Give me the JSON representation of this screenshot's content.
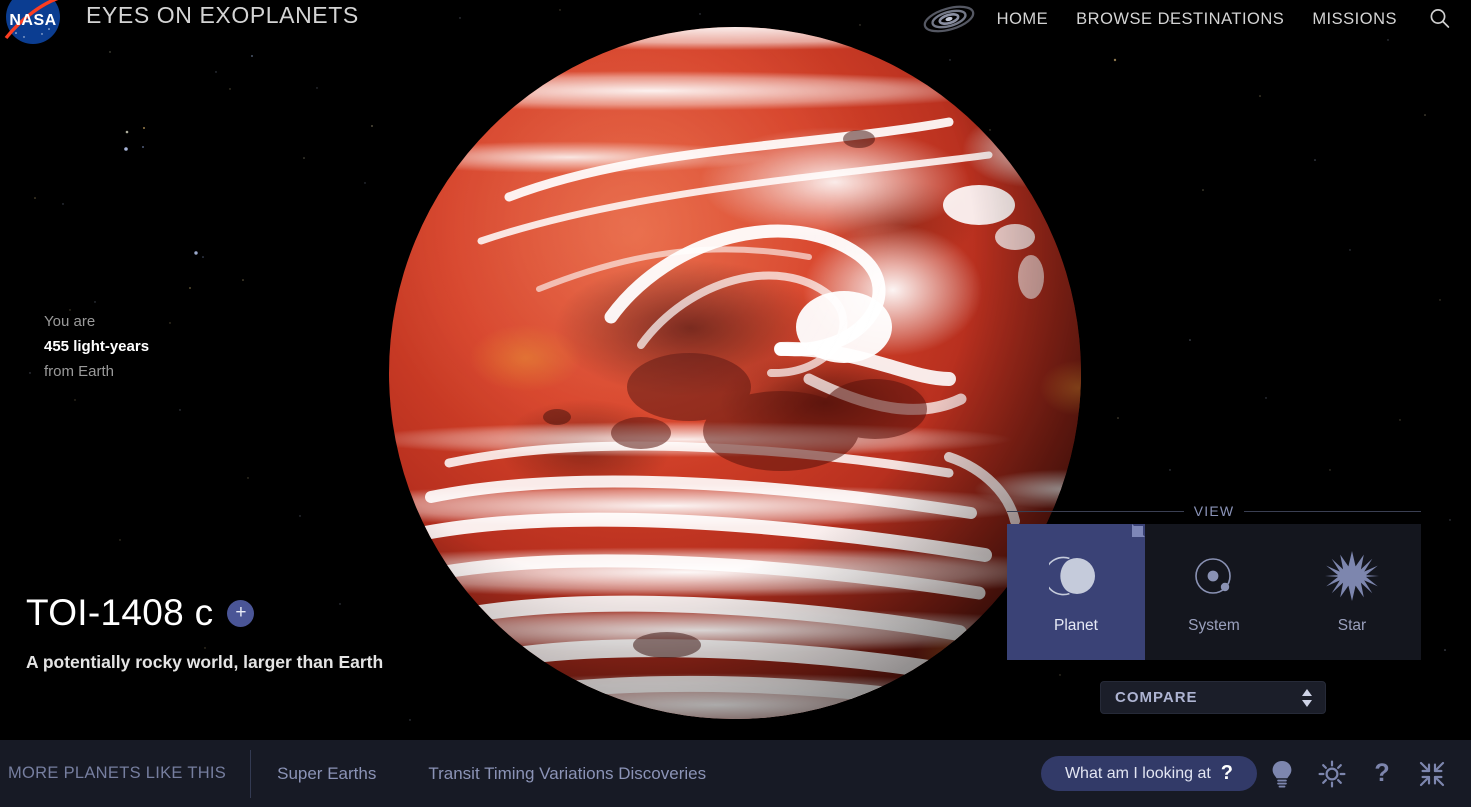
{
  "header": {
    "logo_alt": "NASA",
    "app_title": "EYES ON EXOPLANETS",
    "galaxy_icon": "galaxy-icon",
    "search_icon": "search-icon",
    "nav": [
      {
        "label": "HOME"
      },
      {
        "label": "BROWSE DESTINATIONS"
      },
      {
        "label": "MISSIONS"
      }
    ]
  },
  "distance": {
    "prefix": "You are",
    "value": "455 light-years",
    "suffix": "from Earth"
  },
  "planet": {
    "name": "TOI-1408 c",
    "add_label": "+",
    "tagline": "A potentially rocky world, larger than Earth",
    "appearance": {
      "base_color": "#d8442a",
      "highlight_color": "#e8613c",
      "cloud_color": "#ffffff",
      "shadow_color": "#2e0b07"
    }
  },
  "view_panel": {
    "legend": "VIEW",
    "selected": "Planet",
    "tabs": [
      {
        "label": "Planet",
        "icon": "planet-icon",
        "active": true
      },
      {
        "label": "System",
        "icon": "system-orbit-icon",
        "active": false
      },
      {
        "label": "Star",
        "icon": "star-burst-icon",
        "active": false
      }
    ]
  },
  "compare": {
    "label": "COMPARE",
    "icon": "updown-spinner-icon"
  },
  "bottom_bar": {
    "more_label": "MORE PLANETS LIKE THIS",
    "links": [
      {
        "label": "Super Earths"
      },
      {
        "label": "Transit Timing Variations Discoveries"
      }
    ],
    "what_am_i_looking_at": {
      "label": "What am I looking at",
      "mark": "?"
    },
    "icons": [
      {
        "name": "lightbulb-icon"
      },
      {
        "name": "brightness-sun-icon"
      },
      {
        "name": "help-question-icon",
        "glyph": "?"
      },
      {
        "name": "exit-fullscreen-icon"
      }
    ]
  },
  "colors": {
    "accent_blue": "#3a4276",
    "pill_blue": "#323a68",
    "panel_bg": "#161821",
    "bottom_bar_bg": "#171a25",
    "muted_text": "#8b93b6",
    "space_black": "#000000"
  }
}
